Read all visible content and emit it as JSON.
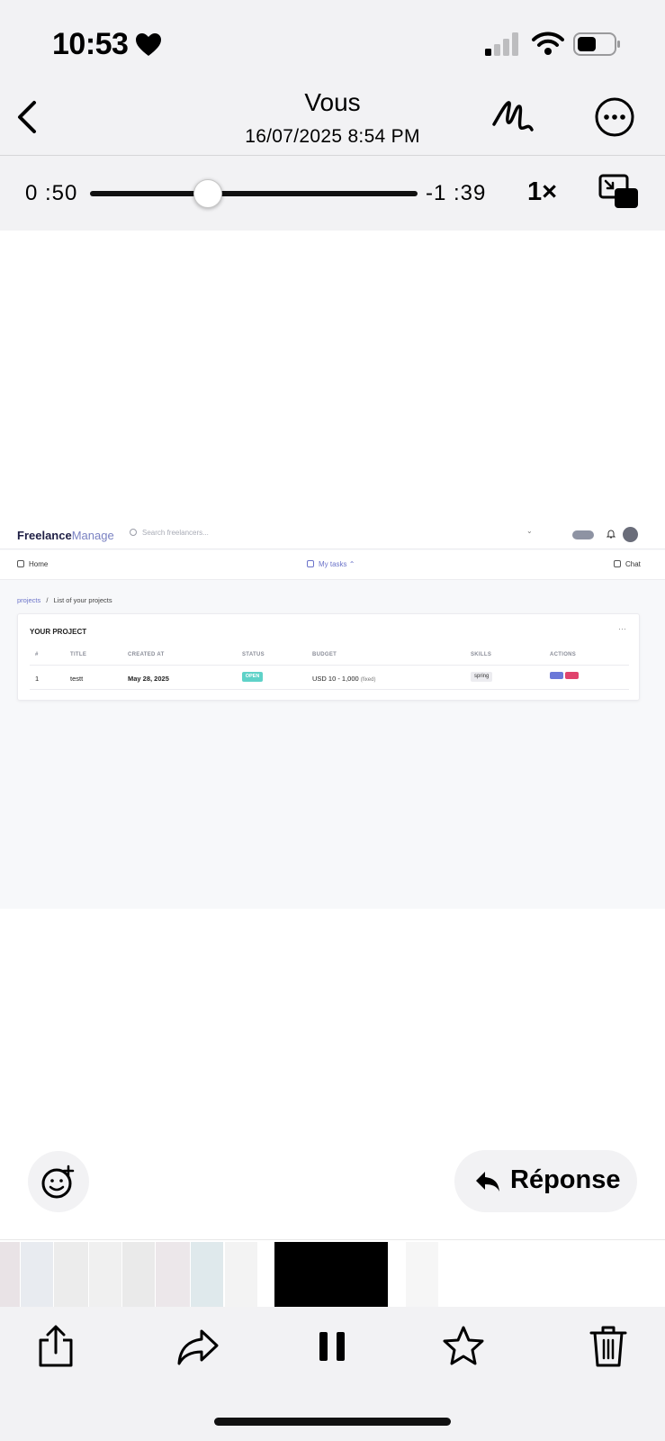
{
  "status_bar": {
    "time": "10:53"
  },
  "header": {
    "title": "Vous",
    "subtitle": "16/07/2025 8:54 PM"
  },
  "player": {
    "elapsed": "0 :50",
    "remaining": "-1 :39",
    "speed": "1×",
    "progress_fraction": 0.36
  },
  "video_frame": {
    "logo_part1": "Freelance",
    "logo_part2": "Manage",
    "search_placeholder": "Search freelancers...",
    "nav": {
      "home": "Home",
      "my_tasks": "My tasks ⌃",
      "chat": "Chat"
    },
    "breadcrumb": {
      "parent": "projects",
      "separator": "/",
      "current": "List of your projects"
    },
    "card": {
      "title": "YOUR PROJECT",
      "more": "···",
      "columns": [
        "#",
        "TITLE",
        "CREATED AT",
        "STATUS",
        "BUDGET",
        "SKILLS",
        "ACTIONS"
      ],
      "rows": [
        {
          "index": "1",
          "title": "testt",
          "created_at": "May 28, 2025",
          "status": "OPEN",
          "budget": "USD 10 - 1,000",
          "budget_note": "(fixed)",
          "skills": "spring"
        }
      ]
    },
    "colors": {
      "status_open": "#5fd2c8",
      "action_edit": "#6b78d8",
      "action_delete": "#e0436d",
      "accent": "#6b73c9"
    }
  },
  "reply": {
    "label": "Réponse"
  },
  "icons": {
    "back": "chevron-left-icon",
    "markup": "markup-pen-icon",
    "more": "ellipsis-circle-icon",
    "pip": "picture-in-picture-icon",
    "emoji": "emoji-add-icon",
    "reply": "reply-arrow-icon",
    "share": "share-icon",
    "forward": "forward-icon",
    "pause": "pause-icon",
    "favorite": "star-icon",
    "delete": "trash-icon"
  }
}
